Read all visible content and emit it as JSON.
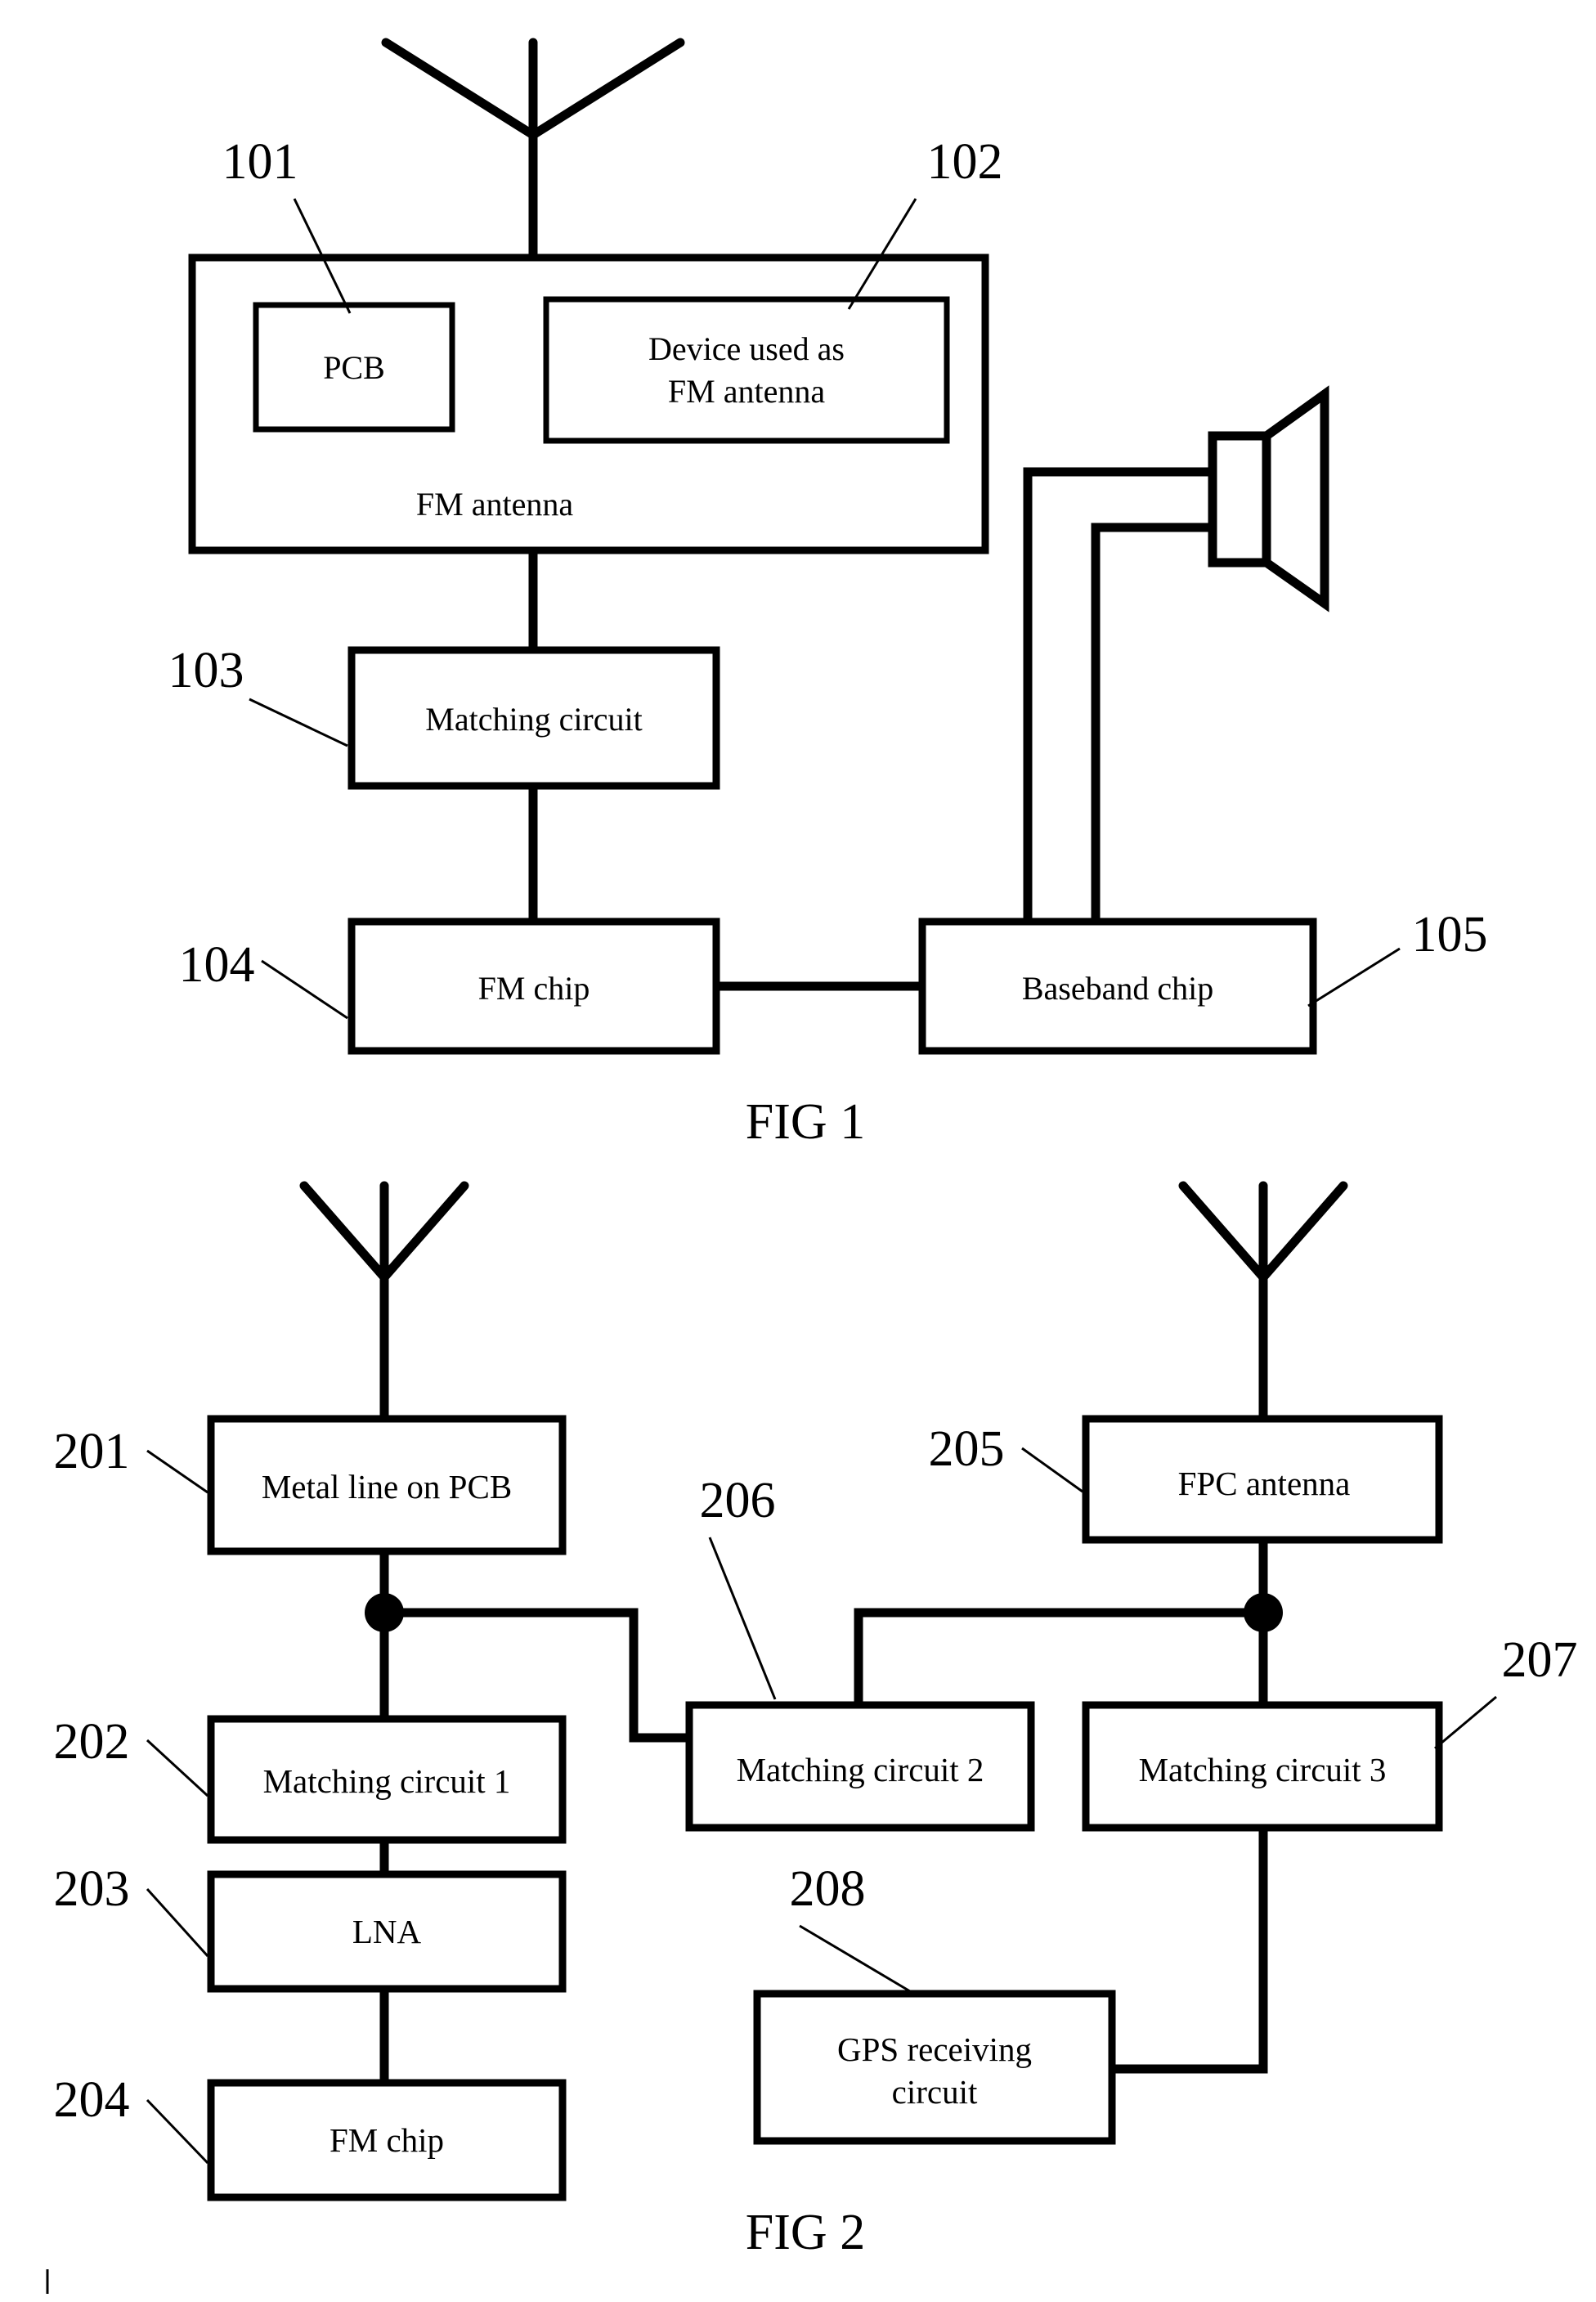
{
  "page": {
    "background": "#ffffff",
    "ink": "#000000"
  },
  "figures": [
    {
      "id": "fig1",
      "caption": "FIG 1",
      "antenna_icon": "whip-antenna-icon",
      "speaker_icon": "speaker-icon",
      "blocks": [
        {
          "key": "fm_antenna",
          "label": "FM antenna",
          "ref": null
        },
        {
          "key": "pcb",
          "label": "PCB",
          "ref": "101"
        },
        {
          "key": "device_fm",
          "label": "Device used as\nFM antenna",
          "ref": "102",
          "line1": "Device used as",
          "line2": "FM antenna"
        },
        {
          "key": "matching",
          "label": "Matching circuit",
          "ref": "103"
        },
        {
          "key": "fm_chip",
          "label": "FM chip",
          "ref": "104"
        },
        {
          "key": "baseband_chip",
          "label": "Baseband chip",
          "ref": "105"
        }
      ],
      "ref_numbers": [
        "101",
        "102",
        "103",
        "104",
        "105"
      ]
    },
    {
      "id": "fig2",
      "caption": "FIG 2",
      "antenna_icon": "whip-antenna-icon",
      "blocks": [
        {
          "key": "metal_line",
          "label": "Metal line on PCB",
          "ref": "201"
        },
        {
          "key": "matching1",
          "label": "Matching circuit 1",
          "ref": "202"
        },
        {
          "key": "lna",
          "label": "LNA",
          "ref": "203"
        },
        {
          "key": "fm_chip2",
          "label": "FM chip",
          "ref": "204"
        },
        {
          "key": "fpc_antenna",
          "label": "FPC antenna",
          "ref": "205"
        },
        {
          "key": "matching2",
          "label": "Matching circuit 2",
          "ref": "206"
        },
        {
          "key": "matching3",
          "label": "Matching circuit 3",
          "ref": "207"
        },
        {
          "key": "gps",
          "label": "GPS receiving\ncircuit",
          "ref": "208",
          "line1": "GPS receiving",
          "line2": "circuit"
        }
      ],
      "ref_numbers": [
        "201",
        "202",
        "203",
        "204",
        "205",
        "206",
        "207",
        "208"
      ]
    }
  ],
  "fig1": {
    "caption": "FIG 1",
    "fm_antenna_label": "FM antenna",
    "pcb_label": "PCB",
    "device_line1": "Device used as",
    "device_line2": "FM antenna",
    "matching_label": "Matching circuit",
    "fm_chip_label": "FM chip",
    "baseband_label": "Baseband chip",
    "ref_101": "101",
    "ref_102": "102",
    "ref_103": "103",
    "ref_104": "104",
    "ref_105": "105"
  },
  "fig2": {
    "caption": "FIG 2",
    "metal_line_label": "Metal line on PCB",
    "matching1_label": "Matching circuit 1",
    "lna_label": "LNA",
    "fm_chip_label": "FM chip",
    "fpc_antenna_label": "FPC antenna",
    "matching2_label": "Matching circuit 2",
    "matching3_label": "Matching circuit 3",
    "gps_line1": "GPS receiving",
    "gps_line2": "circuit",
    "ref_201": "201",
    "ref_202": "202",
    "ref_203": "203",
    "ref_204": "204",
    "ref_205": "205",
    "ref_206": "206",
    "ref_207": "207",
    "ref_208": "208"
  }
}
